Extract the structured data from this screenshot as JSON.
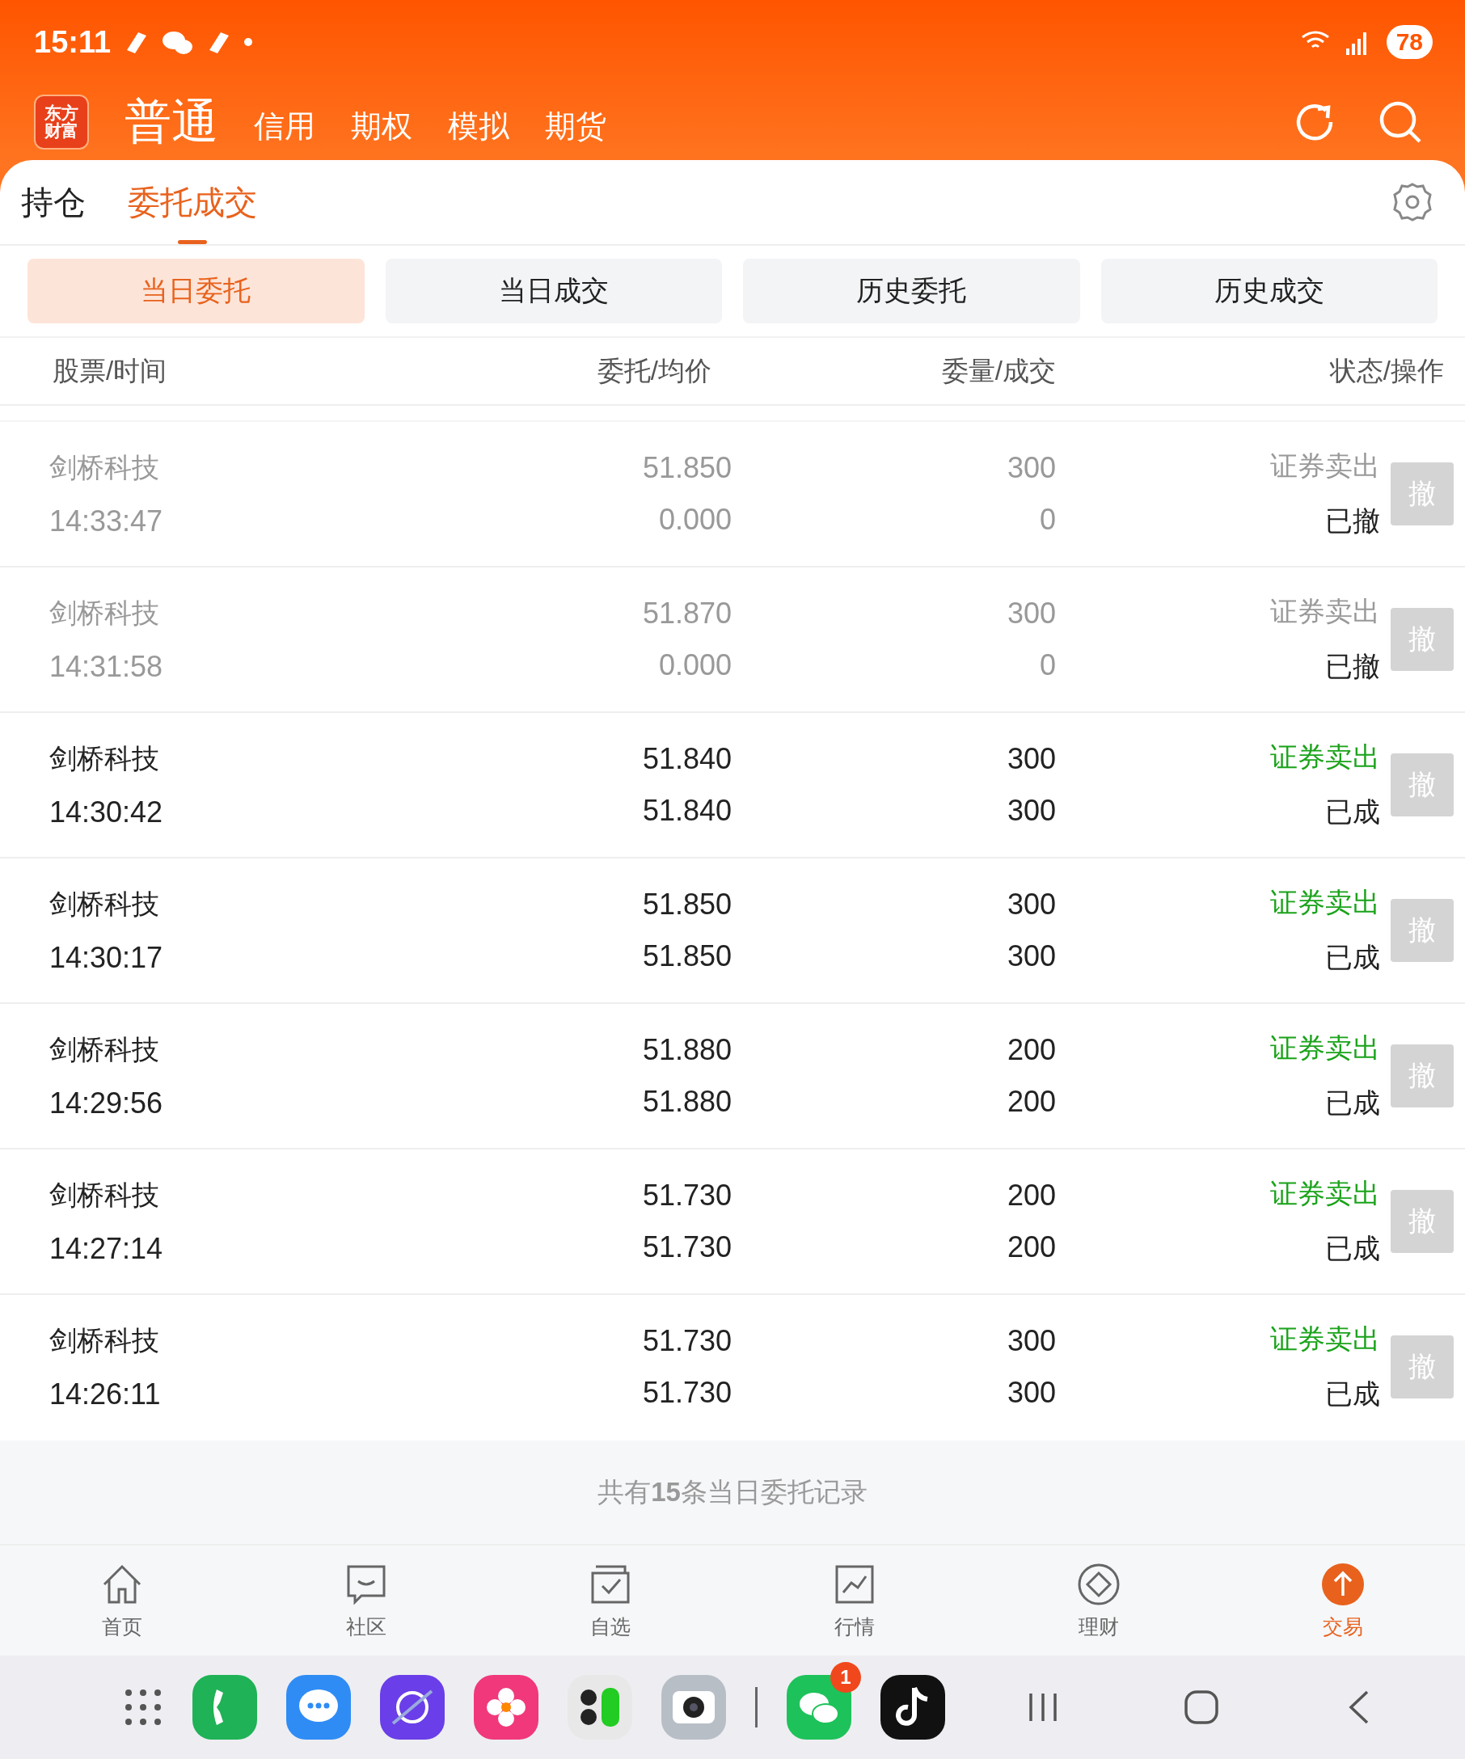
{
  "status_bar": {
    "time": "15:11",
    "battery": "78"
  },
  "header": {
    "logo": [
      "东方",
      "财富"
    ],
    "tabs": [
      {
        "label": "普通",
        "selected": true
      },
      {
        "label": "信用",
        "selected": false
      },
      {
        "label": "期权",
        "selected": false
      },
      {
        "label": "模拟",
        "selected": false
      },
      {
        "label": "期货",
        "selected": false
      }
    ]
  },
  "main_tabs": [
    {
      "label": "持仓",
      "selected": false
    },
    {
      "label": "委托成交",
      "selected": true
    }
  ],
  "segments": [
    {
      "label": "当日委托",
      "selected": true
    },
    {
      "label": "当日成交",
      "selected": false
    },
    {
      "label": "历史委托",
      "selected": false
    },
    {
      "label": "历史成交",
      "selected": false
    }
  ],
  "table": {
    "columns": [
      "股票/时间",
      "委托/均价",
      "委量/成交",
      "状态/操作"
    ],
    "rows": [
      {
        "name": "剑桥科技",
        "time": "14:33:47",
        "price": "51.850",
        "avg_price": "0.000",
        "quantity": "300",
        "filled": "0",
        "direction": "证券卖出",
        "status": "已撤",
        "cancelled": true,
        "action": {
          "label": "撤",
          "disabled": true
        }
      },
      {
        "name": "剑桥科技",
        "time": "14:31:58",
        "price": "51.870",
        "avg_price": "0.000",
        "quantity": "300",
        "filled": "0",
        "direction": "证券卖出",
        "status": "已撤",
        "cancelled": true,
        "action": {
          "label": "撤",
          "disabled": true
        }
      },
      {
        "name": "剑桥科技",
        "time": "14:30:42",
        "price": "51.840",
        "avg_price": "51.840",
        "quantity": "300",
        "filled": "300",
        "direction": "证券卖出",
        "status": "已成",
        "cancelled": false,
        "action": {
          "label": "撤",
          "disabled": true
        }
      },
      {
        "name": "剑桥科技",
        "time": "14:30:17",
        "price": "51.850",
        "avg_price": "51.850",
        "quantity": "300",
        "filled": "300",
        "direction": "证券卖出",
        "status": "已成",
        "cancelled": false,
        "action": {
          "label": "撤",
          "disabled": true
        }
      },
      {
        "name": "剑桥科技",
        "time": "14:29:56",
        "price": "51.880",
        "avg_price": "51.880",
        "quantity": "200",
        "filled": "200",
        "direction": "证券卖出",
        "status": "已成",
        "cancelled": false,
        "action": {
          "label": "撤",
          "disabled": true
        }
      },
      {
        "name": "剑桥科技",
        "time": "14:27:14",
        "price": "51.730",
        "avg_price": "51.730",
        "quantity": "200",
        "filled": "200",
        "direction": "证券卖出",
        "status": "已成",
        "cancelled": false,
        "action": {
          "label": "撤",
          "disabled": true
        }
      },
      {
        "name": "剑桥科技",
        "time": "14:26:11",
        "price": "51.730",
        "avg_price": "51.730",
        "quantity": "300",
        "filled": "300",
        "direction": "证券卖出",
        "status": "已成",
        "cancelled": false,
        "action": {
          "label": "撤",
          "disabled": true
        }
      }
    ]
  },
  "footer": "共有**15**条当日委托记录",
  "bottom_nav": [
    {
      "kind": "home",
      "label": "首页",
      "selected": false
    },
    {
      "kind": "community",
      "label": "社区",
      "selected": false
    },
    {
      "kind": "watchlist",
      "label": "自选",
      "selected": false
    },
    {
      "kind": "market",
      "label": "行情",
      "selected": false
    },
    {
      "kind": "finance",
      "label": "理财",
      "selected": false
    },
    {
      "kind": "trade",
      "label": "交易",
      "selected": true
    }
  ],
  "dock": {
    "apps": [
      {
        "kind": "phone"
      },
      {
        "kind": "messages"
      },
      {
        "kind": "browser"
      },
      {
        "kind": "gallery"
      },
      {
        "kind": "calculator"
      },
      {
        "kind": "camera"
      },
      {
        "kind": "chat",
        "badge": "1"
      },
      {
        "kind": "music"
      }
    ]
  }
}
